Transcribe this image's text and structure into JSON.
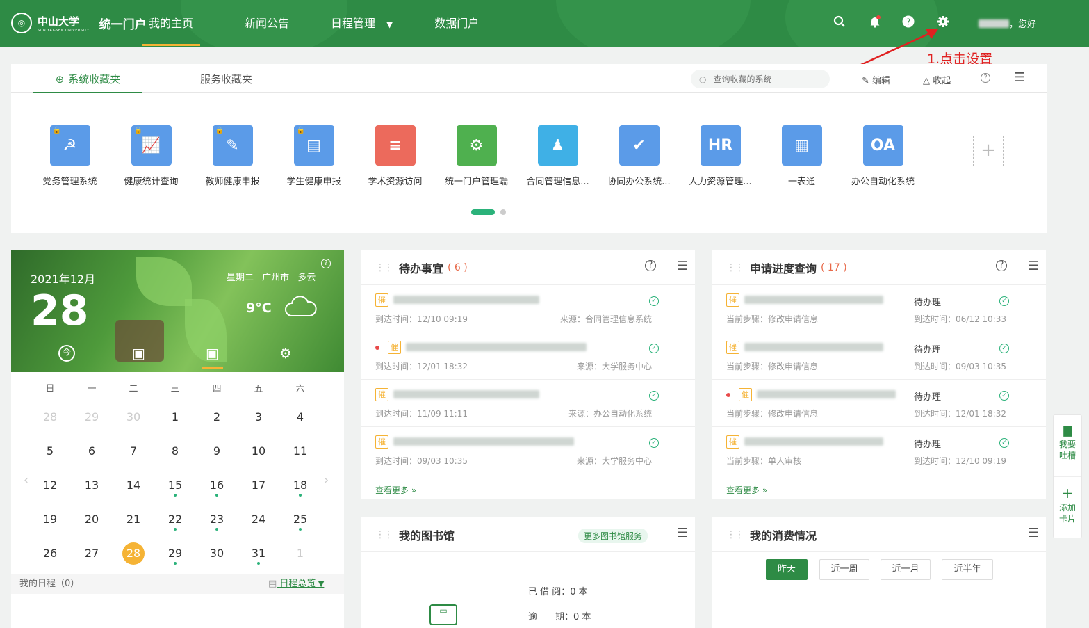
{
  "header": {
    "logo": {
      "name": "中山大学",
      "sub": "SUN YAT-SEN UNIVERSITY",
      "portal": "统一门户"
    },
    "nav": [
      {
        "label": "我的主页"
      },
      {
        "label": "新闻公告"
      },
      {
        "label": "日程管理"
      },
      {
        "label": "数据门户"
      }
    ],
    "greeting": "，您好"
  },
  "annotation": "1.点击设置",
  "favorites": {
    "tabs": [
      {
        "label": "系统收藏夹"
      },
      {
        "label": "服务收藏夹"
      }
    ],
    "search_placeholder": "查询收藏的系统",
    "edit_label": "编辑",
    "collapse_label": "收起",
    "apps": [
      {
        "label": "党务管理系统",
        "color": "#5b9be8",
        "glyph": "☭"
      },
      {
        "label": "健康统计查询",
        "color": "#5b9be8",
        "glyph": "📈"
      },
      {
        "label": "教师健康申报",
        "color": "#5b9be8",
        "glyph": "✎"
      },
      {
        "label": "学生健康申报",
        "color": "#5b9be8",
        "glyph": "▤"
      },
      {
        "label": "学术资源访问",
        "color": "#ec6a5c",
        "glyph": "≡"
      },
      {
        "label": "统一门户管理端",
        "color": "#4fb04f",
        "glyph": "⚙"
      },
      {
        "label": "合同管理信息...",
        "color": "#3fb0e6",
        "glyph": "♟"
      },
      {
        "label": "协同办公系统...",
        "color": "#5b9be8",
        "glyph": "✔"
      },
      {
        "label": "人力资源管理...",
        "color": "#5b9be8",
        "glyph": "HR"
      },
      {
        "label": "一表通",
        "color": "#5b9be8",
        "glyph": "▦"
      },
      {
        "label": "办公自动化系统",
        "color": "#5b9be8",
        "glyph": "OA"
      }
    ]
  },
  "calendar": {
    "year_month": "2021年12月",
    "day": "28",
    "weekday": "星期二",
    "city": "广州市",
    "weather": "多云",
    "temp": "9°C",
    "ctrl_today": "今",
    "weekheads": [
      "日",
      "一",
      "二",
      "三",
      "四",
      "五",
      "六"
    ],
    "weeks": [
      [
        "28",
        "29",
        "30",
        "1",
        "2",
        "3",
        "4"
      ],
      [
        "5",
        "6",
        "7",
        "8",
        "9",
        "10",
        "11"
      ],
      [
        "12",
        "13",
        "14",
        "15",
        "16",
        "17",
        "18"
      ],
      [
        "19",
        "20",
        "21",
        "22",
        "23",
        "24",
        "25"
      ],
      [
        "26",
        "27",
        "28",
        "29",
        "30",
        "31",
        "1"
      ]
    ],
    "footer_left": "我的日程（0）",
    "footer_right": "日程总览"
  },
  "todo": {
    "title": "待办事宜",
    "count": "( 6 )",
    "more": "查看更多",
    "items": [
      {
        "badge": "催",
        "time": "到达时间：12/10 09:19",
        "source": "来源：合同管理信息系统"
      },
      {
        "badge": "催",
        "time": "到达时间：12/01 18:32",
        "source": "来源：大学服务中心"
      },
      {
        "badge": "催",
        "time": "到达时间：11/09 11:11",
        "source": "来源：办公自动化系统"
      },
      {
        "badge": "催",
        "time": "到达时间：09/03 10:35",
        "source": "来源：大学服务中心"
      }
    ]
  },
  "apply": {
    "title": "申请进度查询",
    "count": "( 17 )",
    "more": "查看更多",
    "items": [
      {
        "badge": "催",
        "step": "当前步骤：修改申请信息",
        "status": "待办理",
        "time": "到达时间：06/12 10:33"
      },
      {
        "badge": "催",
        "step": "当前步骤：修改申请信息",
        "status": "待办理",
        "time": "到达时间：09/03 10:35"
      },
      {
        "badge": "催",
        "step": "当前步骤：修改申请信息",
        "status": "待办理",
        "time": "到达时间：12/01 18:32"
      },
      {
        "badge": "催",
        "step": "当前步骤：单人审核",
        "status": "待办理",
        "time": "到达时间：12/10 09:19"
      }
    ]
  },
  "library": {
    "title": "我的图书馆",
    "more_btn": "更多图书馆服务",
    "borrowed": "已 借 阅：0 本",
    "overdue": "逾　　期：0 本"
  },
  "consume": {
    "title": "我的消费情况",
    "ranges": [
      {
        "label": "昨天"
      },
      {
        "label": "近一周"
      },
      {
        "label": "近一月"
      },
      {
        "label": "近半年"
      }
    ]
  },
  "side": {
    "feedback": "我要吐槽",
    "add_card": "添加卡片"
  }
}
